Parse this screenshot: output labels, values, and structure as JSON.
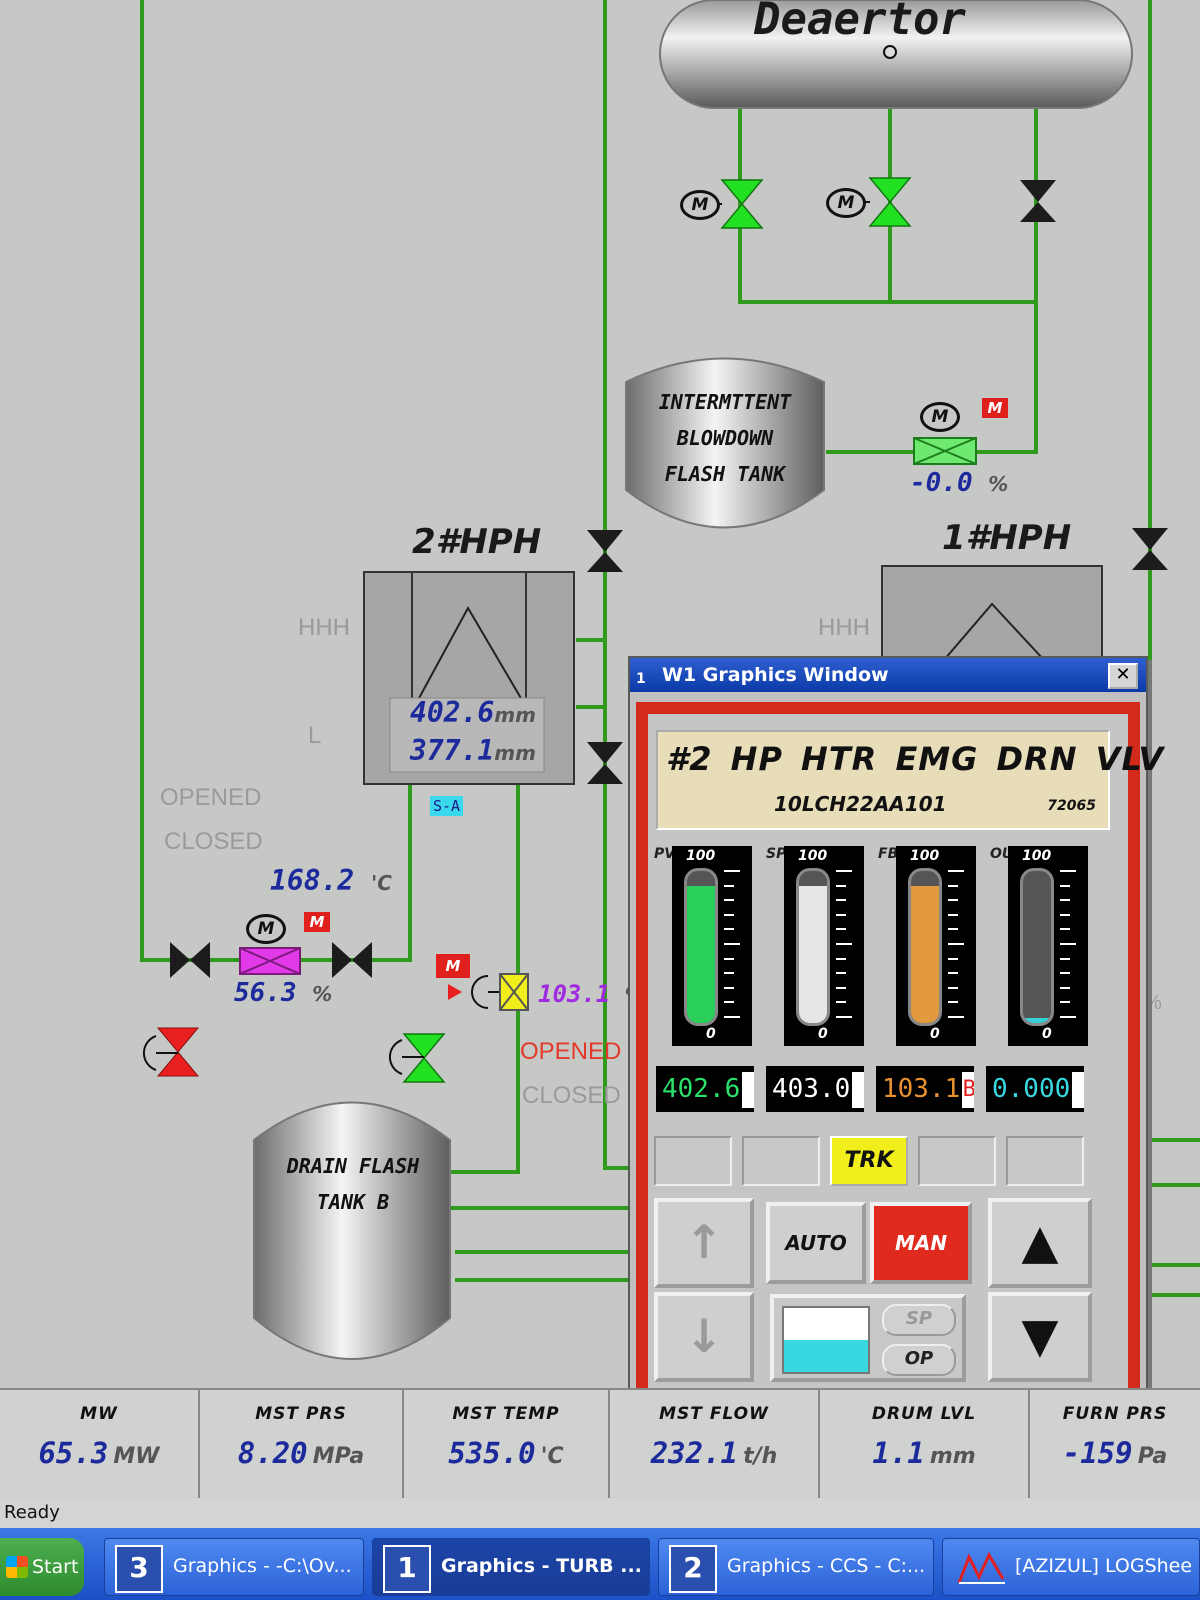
{
  "colors": {
    "pipe": "#2f9a1c",
    "valve_open": "#22e022",
    "valve_closed": "#e02020",
    "value_text": "#1c2a9c",
    "alarm_red": "#e0201c"
  },
  "equipment": {
    "deaerator": "Deaertor",
    "blowdown_tank": [
      "INTERMTTENT",
      "BLOWDOWN",
      "FLASH TANK"
    ],
    "hph2": "2#HPH",
    "hph1": "1#HPH",
    "drain_tank": [
      "DRAIN FLASH",
      "TANK B"
    ]
  },
  "hph2": {
    "level1": "402.6",
    "level2": "377.1",
    "level_unit": "mm",
    "hhh": "HHH",
    "l": "L",
    "tag": "S-A"
  },
  "hph1": {
    "hhh": "HHH"
  },
  "blowdown_valve": {
    "value": "-0.0",
    "unit": "%"
  },
  "temp": {
    "value": "168.2",
    "unit": "'C"
  },
  "drain_valve": {
    "value": "56.3",
    "unit": "%"
  },
  "emg_valve": {
    "value": "103.1",
    "unit": "%",
    "opened": "OPENED",
    "closed": "CLOSED"
  },
  "left_valve_state": {
    "opened": "OPENED",
    "closed": "CLOSED"
  },
  "right_pct": "%",
  "motor_letter": "M",
  "faceplate": {
    "window_title": "W1 Graphics Window",
    "window_index": "1",
    "close": "✕",
    "name": "#2 HP HTR EMG DRN VLV",
    "tag": "10LCH22AA101",
    "num": "72065",
    "bars": [
      {
        "label": "PV",
        "fill": 0.9,
        "color": "#2ad05a",
        "top": "100",
        "bottom": "0"
      },
      {
        "label": "SP",
        "fill": 0.9,
        "color": "#e6e6e6",
        "top": "100",
        "bottom": "0"
      },
      {
        "label": "FB",
        "fill": 0.9,
        "color": "#e39a3e",
        "top": "100",
        "bottom": "0"
      },
      {
        "label": "OUT",
        "fill": 0.0,
        "color": "#38d0d8",
        "top": "100",
        "bottom": "0"
      }
    ],
    "readouts": [
      {
        "text": "402.6",
        "color": "#2ae06a"
      },
      {
        "text": "403.0",
        "color": "#ffffff"
      },
      {
        "text": "103.1",
        "color": "#e8902e",
        "flag": "B"
      },
      {
        "text": "0.000",
        "color": "#38d8e0"
      }
    ],
    "mode_indicator": "TRK",
    "buttons": {
      "auto": "AUTO",
      "man": "MAN",
      "sp": "SP",
      "op": "OP"
    },
    "arrows": {
      "up_light": "↑",
      "down_light": "↓",
      "up": "▲",
      "down": "▼"
    }
  },
  "status_bar": [
    {
      "label": "MW",
      "value": "65.3",
      "unit": "MW"
    },
    {
      "label": "MST PRS",
      "value": "8.20",
      "unit": "MPa"
    },
    {
      "label": "MST TEMP",
      "value": "535.0",
      "unit": "'C"
    },
    {
      "label": "MST FLOW",
      "value": "232.1",
      "unit": "t/h"
    },
    {
      "label": "DRUM LVL",
      "value": "1.1",
      "unit": "mm"
    },
    {
      "label": "FURN PRS",
      "value": "-159",
      "unit": "Pa"
    }
  ],
  "ready": "Ready",
  "taskbar": {
    "start": "Start",
    "items": [
      {
        "badge": "3",
        "label": "Graphics - -C:\\Ov..."
      },
      {
        "badge": "1",
        "label": "Graphics - TURB ..."
      },
      {
        "badge": "2",
        "label": "Graphics - CCS - C:..."
      },
      {
        "badge": "",
        "label": "[AZIZUL] LOGShee"
      }
    ]
  }
}
